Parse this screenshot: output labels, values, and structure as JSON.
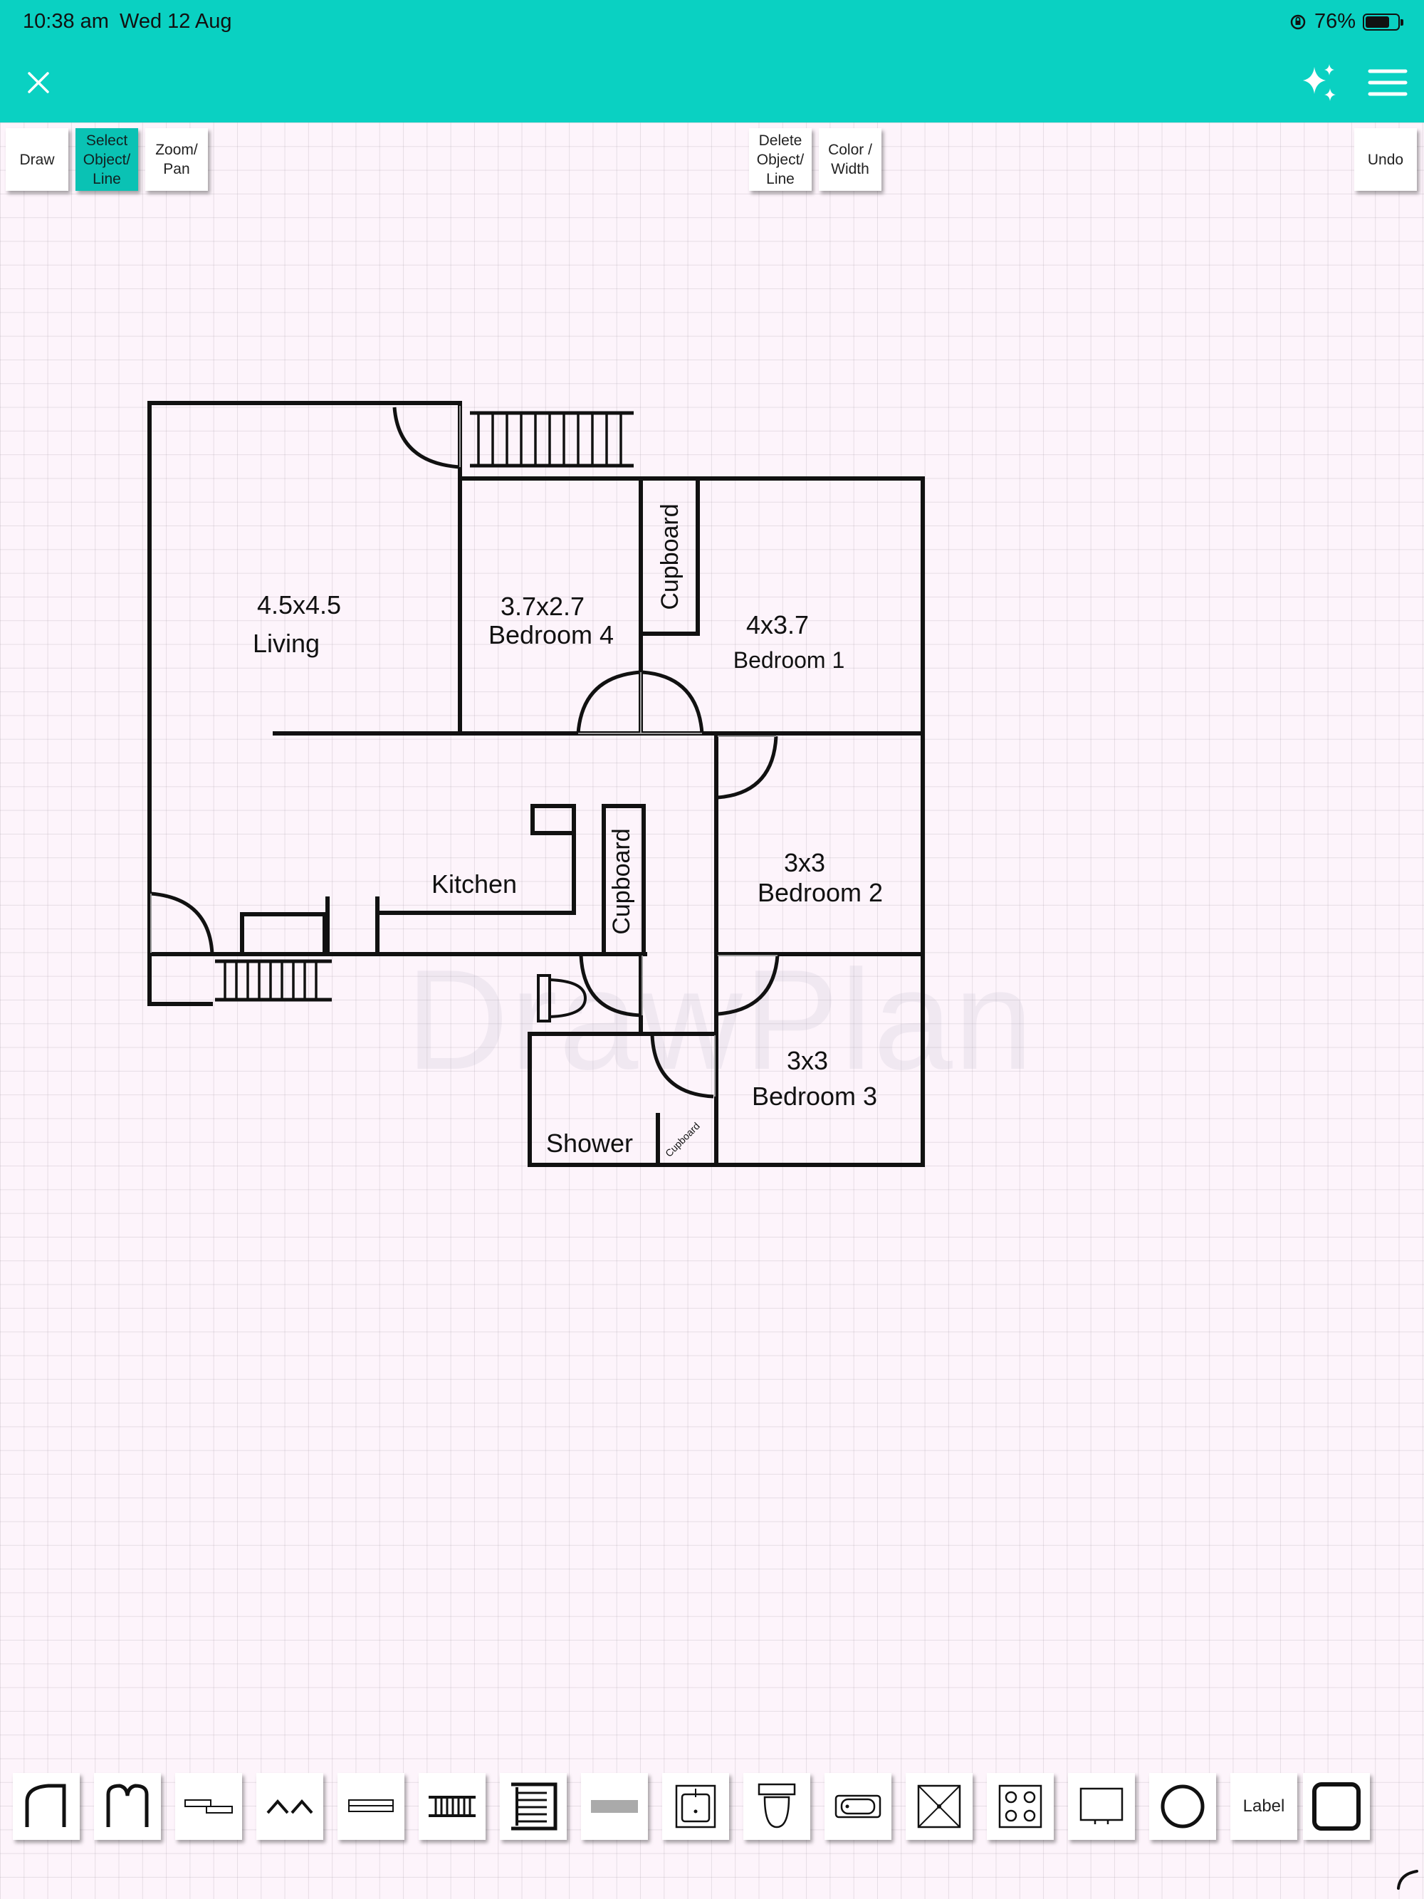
{
  "status_bar": {
    "time": "10:38 am",
    "date": "Wed 12 Aug",
    "battery": "76%",
    "battery_level": 0.76
  },
  "header": {
    "close_icon": "close-icon",
    "sparkle_icon": "sparkle-icon",
    "menu_icon": "hamburger-menu-icon",
    "color": "#0ad1c2"
  },
  "toolbar": {
    "draw": "Draw",
    "select": "Select\nObject/\nLine",
    "zoom": "Zoom/\nPan",
    "delete": "Delete\nObject/\nLine",
    "color": "Color /\nWidth",
    "undo": "Undo",
    "active_color": "#0ac2b4"
  },
  "plan": {
    "living_size": "4.5x4.5",
    "living_name": "Living",
    "bed4_size": "3.7x2.7",
    "bed4_name": "Bedroom 4",
    "cupboard_1": "Cupboard",
    "bed1_size": "4x3.7",
    "bed1_name": "Bedroom 1",
    "kitchen": "Kitchen",
    "cupboard_2": "Cupboard",
    "bed2_size": "3x3",
    "bed2_name": "Bedroom 2",
    "bed3_size": "3x3",
    "bed3_name": "Bedroom 3",
    "shower": "Shower",
    "cupboard_small": "Cupboard"
  },
  "watermark": "DrawPlan",
  "palette": {
    "items": [
      "single-door-icon",
      "double-door-icon",
      "sliding-door-icon",
      "bifold-door-icon",
      "window-icon",
      "stairs-icon",
      "staircase-landing-icon",
      "bench-icon",
      "sink-icon",
      "toilet-icon",
      "bath-icon",
      "shower-icon",
      "stove-icon",
      "tv-icon",
      "circle-icon",
      "label-tool",
      "rectangle-icon"
    ],
    "label": "Label"
  }
}
